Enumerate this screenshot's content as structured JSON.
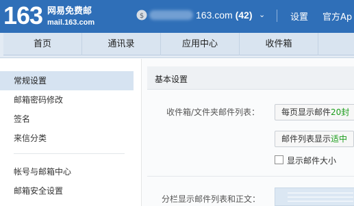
{
  "header": {
    "logo_number": "163",
    "logo_cn": "网易免费邮",
    "logo_url": "mail.163.com",
    "account_domain": "163.com",
    "unread_count": "(42)",
    "chevron": "⌄",
    "settings_link": "设置",
    "app_link": "官方Ap"
  },
  "nav": {
    "tabs": [
      {
        "label": "首页"
      },
      {
        "label": "通讯录"
      },
      {
        "label": "应用中心"
      },
      {
        "label": "收件箱"
      }
    ]
  },
  "sidebar": {
    "items": [
      {
        "label": "常规设置"
      },
      {
        "label": "邮箱密码修改"
      },
      {
        "label": "签名"
      },
      {
        "label": "来信分类"
      },
      {
        "label": "帐号与邮箱中心"
      },
      {
        "label": "邮箱安全设置"
      }
    ]
  },
  "main": {
    "section_title": "基本设置",
    "list_label": "收件箱/文件夹邮件列表：",
    "per_page_text": "每页显示邮件",
    "per_page_value": "20封",
    "display_text": "邮件列表显示",
    "display_value": "适中",
    "show_size_label": "显示邮件大小",
    "split_label": "分栏显示邮件列表和正文："
  },
  "colors": {
    "header_bg": "#2f6fb8",
    "active_sidebar": "#d6e3f1",
    "accent_green": "#1a9c1a"
  }
}
